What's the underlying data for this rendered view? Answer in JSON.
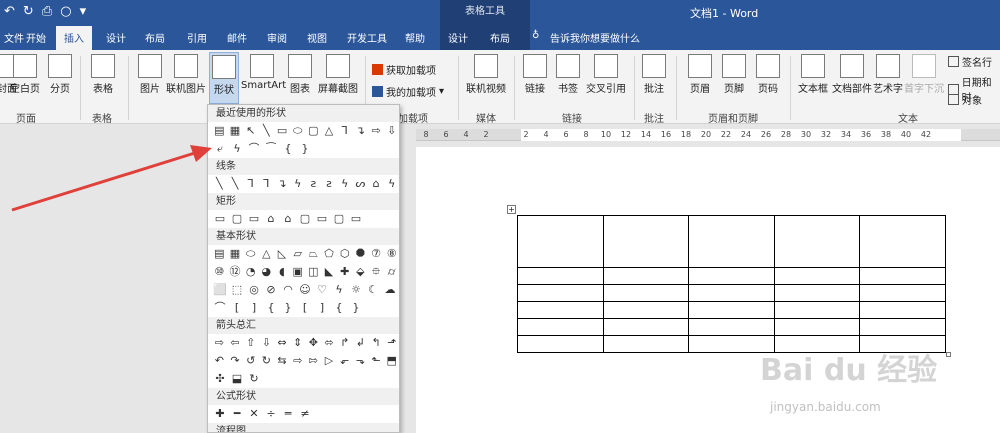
{
  "titlebar": {
    "contextual_title": "表格工具",
    "document_title": "文档1 - Word"
  },
  "tabs": {
    "file": "文件",
    "home": "开始",
    "insert": "插入",
    "design": "设计",
    "layout": "布局",
    "references": "引用",
    "mailings": "邮件",
    "review": "审阅",
    "view": "视图",
    "developer": "开发工具",
    "help": "帮助",
    "table_design": "设计",
    "table_layout": "布局",
    "tell_me": "告诉我你想要做什么"
  },
  "ribbon": {
    "cover_page": "封面",
    "blank_page": "空白页",
    "page_break": "分页",
    "pages_group": "页面",
    "table": "表格",
    "tables_group": "表格",
    "pictures": "图片",
    "online_pictures": "联机图片",
    "shapes": "形状",
    "smartart": "SmartArt",
    "chart": "图表",
    "screenshot": "屏幕截图",
    "get_addins": "获取加载项",
    "my_addins": "我的加载项",
    "addins_group": "加载项",
    "online_video": "联机视频",
    "media_group": "媒体",
    "link": "链接",
    "bookmark": "书签",
    "cross_reference": "交叉引用",
    "links_group": "链接",
    "comment": "批注",
    "comments_group": "批注",
    "header": "页眉",
    "footer": "页脚",
    "page_number": "页码",
    "header_footer_group": "页眉和页脚",
    "textbox": "文本框",
    "quick_parts": "文档部件",
    "wordart": "艺术字",
    "dropcap": "首字下沉",
    "signature_line": "签名行",
    "date_time": "日期和时",
    "object": "对象",
    "text_group": "文本"
  },
  "ruler": {
    "ticks": [
      "8",
      "6",
      "4",
      "2",
      "",
      "2",
      "4",
      "6",
      "8",
      "10",
      "12",
      "14",
      "16",
      "18",
      "20",
      "22",
      "24",
      "26",
      "28",
      "30",
      "32",
      "34",
      "36",
      "38",
      "40",
      "42"
    ]
  },
  "shapes_panel": {
    "sections": [
      {
        "title": "最近使用的形状",
        "rows": [
          [
            "▤",
            "▦",
            "↖",
            "╲",
            "▭",
            "⬭",
            "▢",
            "△",
            "⅂",
            "↴",
            "⇨",
            "⇩"
          ],
          [
            "⤶",
            "ϟ",
            "⌒",
            "⁀",
            "{",
            "}"
          ]
        ]
      },
      {
        "title": "线条",
        "rows": [
          [
            "╲",
            "╲",
            "⅂",
            "⅂",
            "↴",
            "ϟ",
            "ƨ",
            "ƨ",
            "ϟ",
            "ᔕ",
            "⌂",
            "ϟ"
          ]
        ]
      },
      {
        "title": "矩形",
        "rows": [
          [
            "▭",
            "▢",
            "▭",
            "⌂",
            "⌂",
            "▢",
            "▭",
            "▢",
            "▭"
          ]
        ]
      },
      {
        "title": "基本形状",
        "rows": [
          [
            "▤",
            "▦",
            "⬭",
            "△",
            "◺",
            "▱",
            "⏢",
            "⬠",
            "⬡",
            "⯃",
            "⑦",
            "⑧"
          ],
          [
            "⑩",
            "⑫",
            "◔",
            "◕",
            "◖",
            "▣",
            "◫",
            "◣",
            "✚",
            "⬙",
            "⯐",
            "⌭"
          ],
          [
            "⬜",
            "⬚",
            "◎",
            "⊘",
            "◠",
            "☺",
            "♡",
            "ϟ",
            "☼",
            "☾",
            "☁"
          ],
          [
            "⌒",
            "[",
            "]",
            "{",
            "}",
            "[",
            "]",
            "{",
            "}"
          ]
        ]
      },
      {
        "title": "箭头总汇",
        "rows": [
          [
            "⇨",
            "⇦",
            "⇧",
            "⇩",
            "⇔",
            "⇕",
            "✥",
            "⬄",
            "↱",
            "↲",
            "↰",
            "⬏"
          ],
          [
            "↶",
            "↷",
            "↺",
            "↻",
            "⇆",
            "⇨",
            "⇰",
            "▷",
            "⬐",
            "⬎",
            "⬑",
            "⬒"
          ],
          [
            "✣",
            "⬓",
            "↻"
          ]
        ]
      },
      {
        "title": "公式形状",
        "rows": [
          [
            "✚",
            "━",
            "✕",
            "÷",
            "═",
            "≠"
          ]
        ]
      },
      {
        "title": "流程图",
        "rows": []
      }
    ]
  },
  "watermark": {
    "text": "Bai du 经验",
    "url": "jingyan.baidu.com"
  },
  "colors": {
    "titlebar": "#2b579a",
    "contextual": "#203f74",
    "arrow": "#e0403a"
  }
}
